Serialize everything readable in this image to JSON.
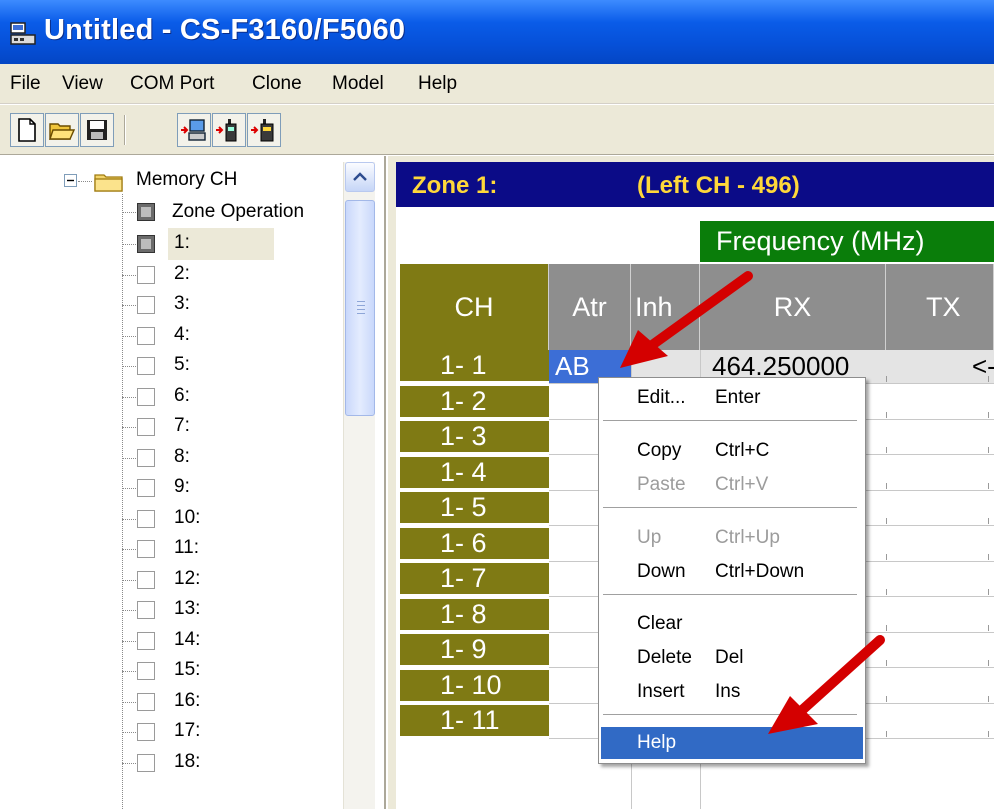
{
  "window": {
    "title": "Untitled - CS-F3160/F5060"
  },
  "menubar": {
    "items": [
      "File",
      "View",
      "COM Port",
      "Clone",
      "Model",
      "Help"
    ]
  },
  "toolbar": {
    "icons": [
      "new-file-icon",
      "open-folder-icon",
      "save-icon",
      "read-from-radio-icon",
      "write-to-radio-icon",
      "radio-info-icon"
    ]
  },
  "tree": {
    "root": "Memory CH",
    "zone_operation": "Zone Operation",
    "selected": "1:",
    "channels": [
      "1:",
      "2:",
      "3:",
      "4:",
      "5:",
      "6:",
      "7:",
      "8:",
      "9:",
      "10:",
      "11:",
      "12:",
      "13:",
      "14:",
      "15:",
      "16:",
      "17:",
      "18:"
    ]
  },
  "grid": {
    "zone_title": "Zone 1:",
    "zone_range": "(Left CH - 496)",
    "frequency_header": "Frequency (MHz)",
    "columns": {
      "ch": "CH",
      "atr": "Atr",
      "inh": "Inh",
      "rx": "RX",
      "tx": "TX"
    },
    "rows": [
      "1- 1",
      "1- 2",
      "1- 3",
      "1- 4",
      "1- 5",
      "1- 6",
      "1- 7",
      "1- 8",
      "1- 9",
      "1- 10",
      "1- 11"
    ],
    "row1": {
      "atr": "AB",
      "rx": "464.250000",
      "tx": "<-"
    }
  },
  "context_menu": {
    "items": [
      {
        "label": "Edit...",
        "shortcut": "Enter",
        "enabled": true
      },
      {
        "label": "Copy",
        "shortcut": "Ctrl+C",
        "enabled": true
      },
      {
        "label": "Paste",
        "shortcut": "Ctrl+V",
        "enabled": false
      },
      {
        "label": "Up",
        "shortcut": "Ctrl+Up",
        "enabled": false
      },
      {
        "label": "Down",
        "shortcut": "Ctrl+Down",
        "enabled": true
      },
      {
        "label": "Clear",
        "shortcut": "",
        "enabled": true
      },
      {
        "label": "Delete",
        "shortcut": "Del",
        "enabled": true
      },
      {
        "label": "Insert",
        "shortcut": "Ins",
        "enabled": true
      },
      {
        "label": "Help",
        "shortcut": "",
        "enabled": true,
        "highlighted": true
      }
    ]
  },
  "colors": {
    "zone_bar": "#0b0b87",
    "zone_text": "#ffd83a",
    "ch_column": "#7f7a14",
    "frequency_header": "#0a7d0a",
    "menu_highlight": "#316ac5",
    "annotation_arrow": "#d40000"
  }
}
